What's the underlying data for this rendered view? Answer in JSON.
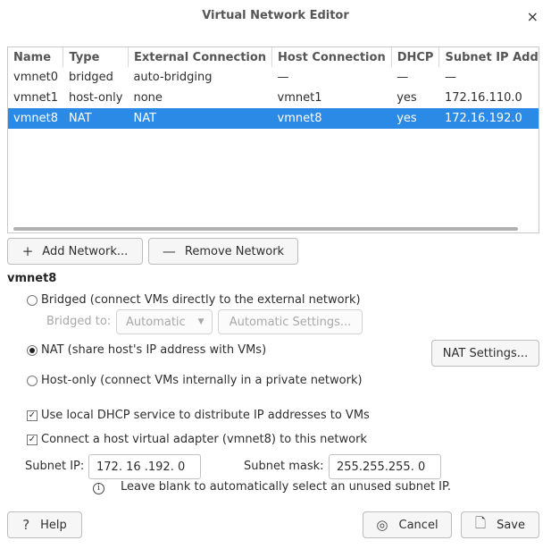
{
  "window": {
    "title": "Virtual Network Editor",
    "close_glyph": "×"
  },
  "table": {
    "headers": [
      "Name",
      "Type",
      "External Connection",
      "Host Connection",
      "DHCP",
      "Subnet IP Address"
    ],
    "rows": [
      [
        "vmnet0",
        "bridged",
        "auto-bridging",
        "—",
        "—",
        "—"
      ],
      [
        "vmnet1",
        "host-only",
        "none",
        "vmnet1",
        "yes",
        "172.16.110.0"
      ],
      [
        "vmnet8",
        "NAT",
        "NAT",
        "vmnet8",
        "yes",
        "172.16.192.0"
      ]
    ],
    "selected_row": 2
  },
  "buttons": {
    "add_network": "Add Network...",
    "add_icon": "+",
    "remove_network": "Remove Network",
    "remove_icon": "—",
    "nat_settings": "NAT Settings...",
    "automatic_settings": "Automatic Settings...",
    "help": "Help",
    "help_icon": "?",
    "cancel": "Cancel",
    "cancel_icon": "◎",
    "save": "Save",
    "save_icon": "🗋"
  },
  "network": {
    "selected_name": "vmnet8",
    "bridged_label": "Bridged (connect VMs directly to the external network)",
    "bridged_to_label": "Bridged to:",
    "bridged_to_value": "Automatic",
    "nat_label": "NAT (share host's IP address with VMs)",
    "hostonly_label": "Host-only (connect VMs internally in a private network)",
    "connection_type": "nat",
    "dhcp_label": "Use local DHCP service to distribute IP addresses to VMs",
    "dhcp_checked": true,
    "adapter_label": "Connect a host virtual adapter (vmnet8) to this network",
    "adapter_checked": true,
    "subnet_ip_label": "Subnet IP:",
    "subnet_ip_value": "172. 16 .192.  0",
    "subnet_mask_label": "Subnet mask:",
    "subnet_mask_value": "255.255.255.  0",
    "hint": "Leave blank to automatically select an unused subnet IP."
  },
  "colors": {
    "selection": "#2b8ae6"
  }
}
